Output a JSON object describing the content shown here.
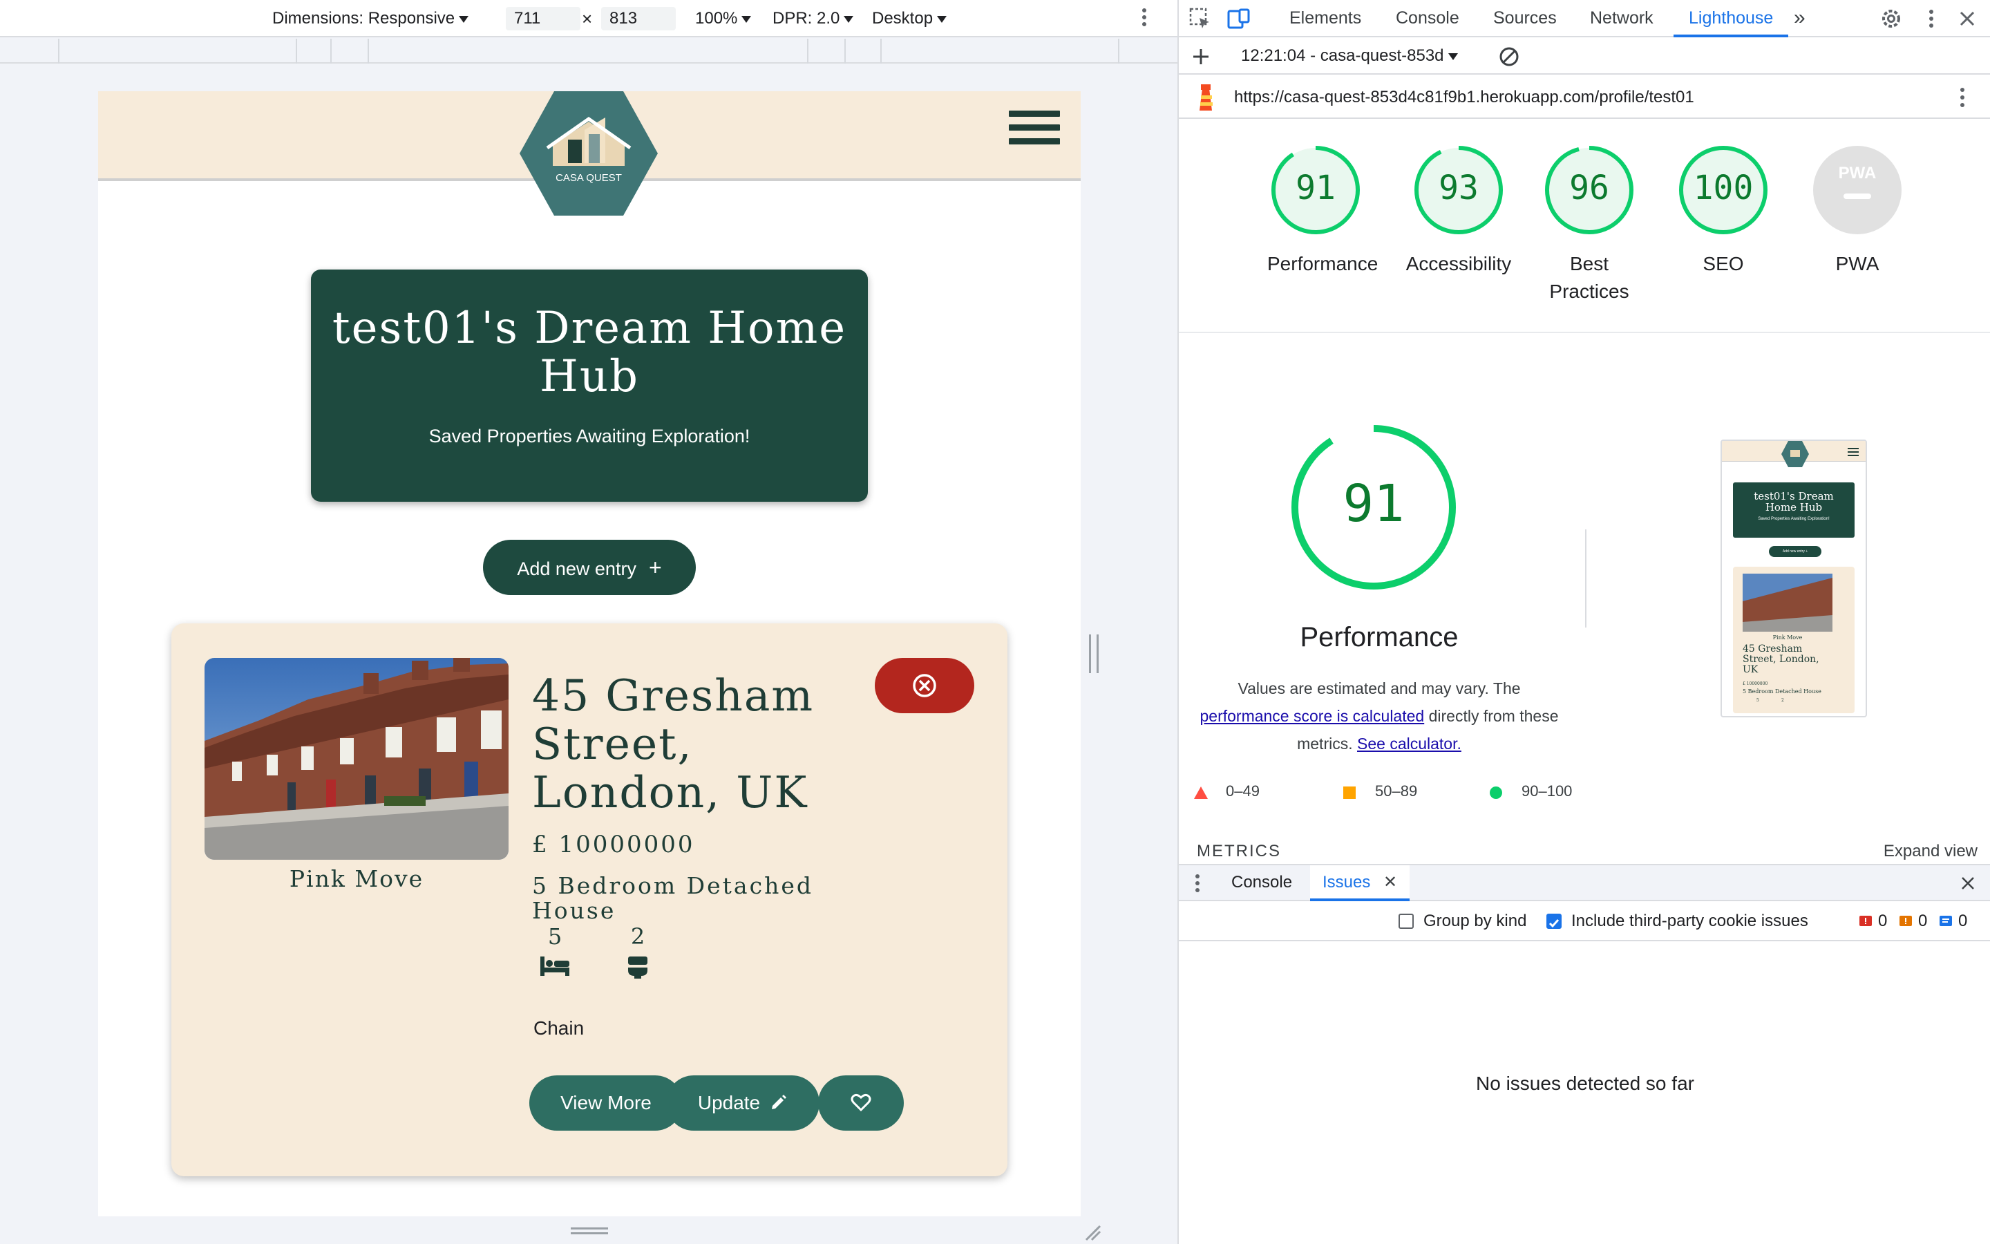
{
  "device_toolbar": {
    "dimensions_label": "Dimensions: Responsive",
    "width": "711",
    "times": "×",
    "height": "813",
    "zoom": "100%",
    "dpr": "DPR: 2.0",
    "mode": "Desktop"
  },
  "site": {
    "logo_text": "CASA QUEST",
    "hero_title": "test01's Dream Home Hub",
    "hero_subtitle": "Saved Properties Awaiting Exploration!",
    "add_entry_label": "Add new entry",
    "add_entry_plus": "+",
    "card": {
      "photo_caption": "Pink Move",
      "address": "45 Gresham Street, London, UK",
      "price": "£ 10000000",
      "property_type": "5 Bedroom Detached House",
      "bedrooms": "5",
      "bathrooms": "2",
      "chain": "Chain",
      "view_more_label": "View More",
      "update_label": "Update"
    }
  },
  "devtools": {
    "tabs": [
      "Elements",
      "Console",
      "Sources",
      "Network",
      "Lighthouse"
    ],
    "active_tab": "Lighthouse",
    "report_time": "12:21:04 - casa-quest-853d",
    "url": "https://casa-quest-853d4c81f9b1.herokuapp.com/profile/test01",
    "scores": [
      {
        "value": "91",
        "label": "Performance"
      },
      {
        "value": "93",
        "label": "Accessibility"
      },
      {
        "value": "96",
        "label": "Best Practices"
      },
      {
        "value": "100",
        "label": "SEO"
      }
    ],
    "pwa_label": "PWA",
    "pwa_badge": "PWA",
    "performance": {
      "score": "91",
      "title": "Performance",
      "desc_1": "Values are estimated and may vary. The",
      "desc_link1": "performance score is calculated",
      "desc_2": "directly from these metrics.",
      "desc_link2": "See calculator."
    },
    "legend": [
      "0–49",
      "50–89",
      "90–100"
    ],
    "metrics_label": "METRICS",
    "expand_label": "Expand view",
    "thumbnail": {
      "title": "test01's Dream Home Hub",
      "subtitle": "Saved Properties Awaiting Exploration!",
      "add_label": "Add new entry +",
      "caption": "Pink Move",
      "address": "45 Gresham Street, London, UK",
      "price": "£ 10000000",
      "type": "5 Bedroom Detached House",
      "beds": "5",
      "baths": "2"
    },
    "drawer": {
      "tabs": [
        "Console",
        "Issues"
      ],
      "active": "Issues",
      "group_by_kind": "Group by kind",
      "third_party": "Include third-party cookie issues",
      "error_count": "0",
      "warning_count": "0",
      "info_count": "0",
      "empty_message": "No issues detected so far"
    },
    "colors": {
      "pass": "#0cce6b",
      "average": "#ffa400",
      "fail": "#ff4e42",
      "accent": "#1a73e8"
    }
  }
}
